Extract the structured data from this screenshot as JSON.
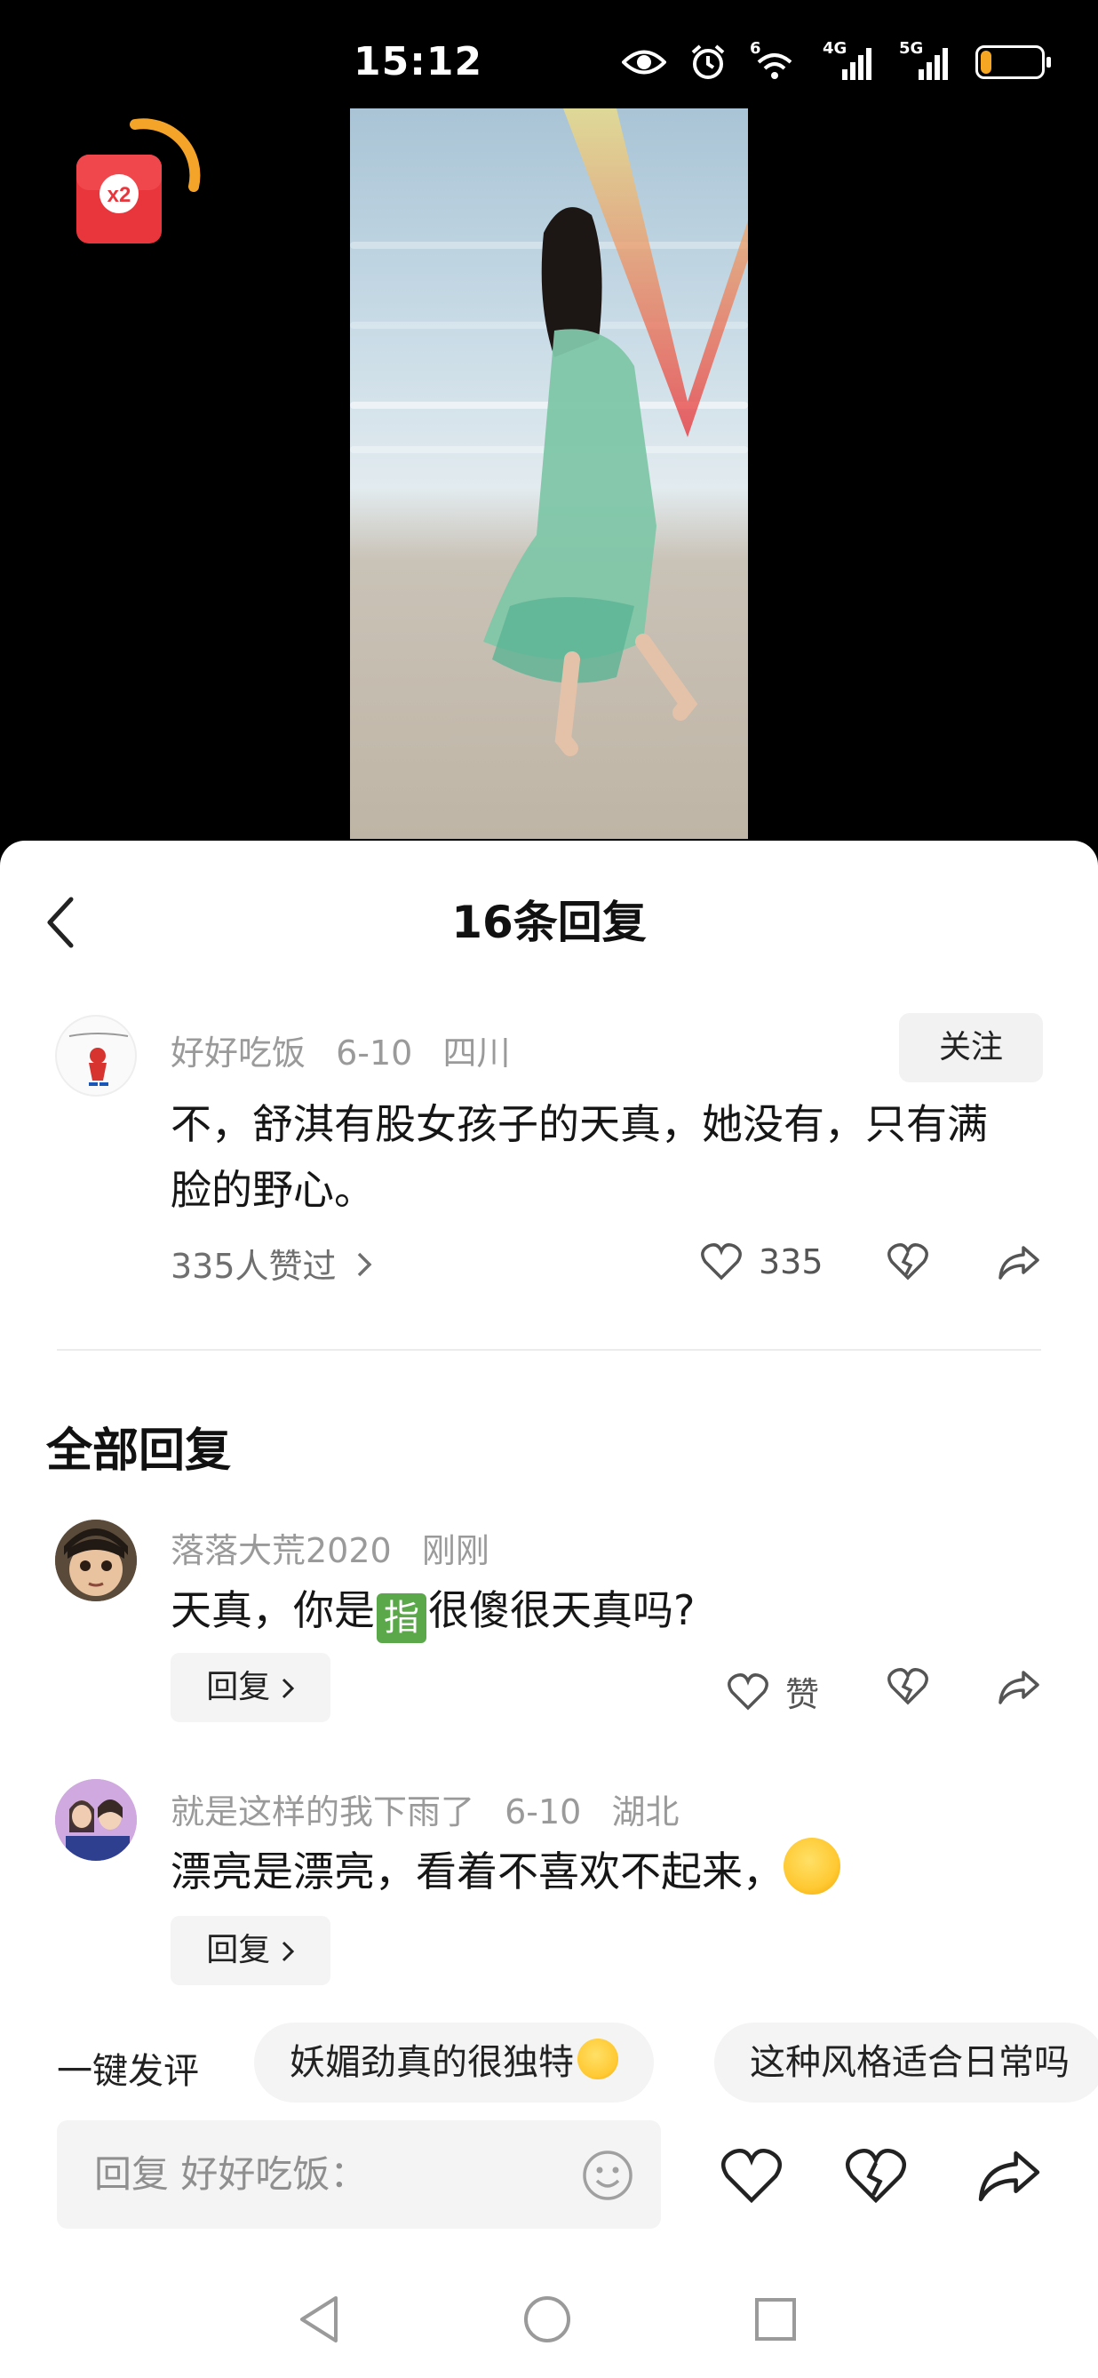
{
  "status_bar": {
    "time": "15:12",
    "battery": "15",
    "battery_level": 0.15,
    "wifi_label": "6",
    "signal1_label": "4G",
    "signal2_label": "5G",
    "icons": [
      "eye-icon",
      "alarm-icon",
      "wifi-icon",
      "signal-4g-icon",
      "signal-5g-icon",
      "battery-icon"
    ]
  },
  "red_packet": {
    "label": "x2"
  },
  "sheet": {
    "title": "16条回复"
  },
  "main_comment": {
    "username": "好好吃饭",
    "date": "6-10",
    "location": "四川",
    "follow_label": "关注",
    "text": "不，舒淇有股女孩子的天真，她没有，只有满脸的野心。",
    "likes_link": "335人赞过",
    "like_count": "335"
  },
  "section_title": "全部回复",
  "replies": [
    {
      "username": "落落大荒2020",
      "date": "刚刚",
      "text_before": "天真，你是",
      "emoji_char": "指",
      "text_after": "很傻很天真吗?",
      "reply_label": "回复",
      "like_label": "赞"
    },
    {
      "username": "就是这样的我下雨了",
      "date": "6-10",
      "location": "湖北",
      "text": "漂亮是漂亮，看着不喜欢不起来，",
      "reply_label": "回复"
    }
  ],
  "quick_comments": {
    "label": "一键发评",
    "chips": [
      "妖媚劲真的很独特",
      "这种风格适合日常吗"
    ]
  },
  "input": {
    "placeholder": "回复 好好吃饭："
  }
}
